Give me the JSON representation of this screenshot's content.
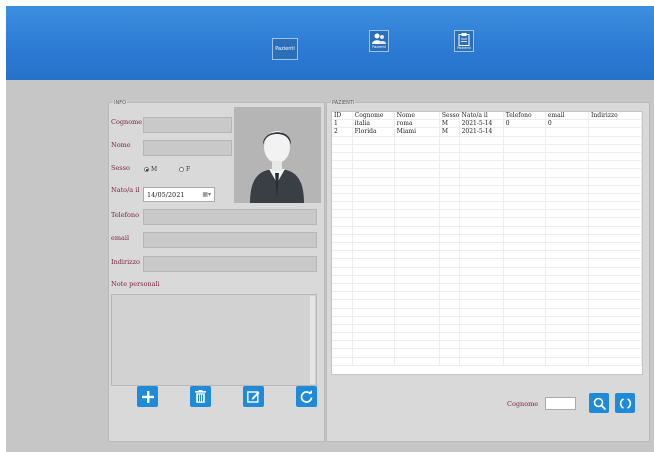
{
  "toolbar": {
    "buttons": [
      {
        "label": "Pazienti",
        "icon": "list-icon"
      },
      {
        "label": "Pazienti",
        "icon": "users-icon"
      },
      {
        "label": "Pazienti",
        "icon": "clipboard-icon"
      }
    ]
  },
  "info": {
    "legend": "INFO",
    "labels": {
      "cognome": "Cognome",
      "nome": "Nome",
      "sesso": "Sesso",
      "nato": "Nato/a il",
      "telefono": "Telefono",
      "email": "email",
      "indirizzo": "Indirizzo",
      "note": "Note personali"
    },
    "values": {
      "cognome": "",
      "nome": "",
      "telefono": "",
      "email": "",
      "indirizzo": "",
      "note": ""
    },
    "sesso_options": [
      "M",
      "F"
    ],
    "sesso_selected": "M",
    "date_value": "14/05/2021"
  },
  "pazienti": {
    "legend": "PAZIENTI",
    "columns": [
      "ID",
      "Cognome",
      "Nome",
      "Sesso",
      "Nato/a il",
      "Telefono",
      "email",
      "Indirizzo"
    ],
    "rows": [
      [
        "1",
        "italia",
        "roma",
        "M",
        "2021-5-14",
        "0",
        "0",
        ""
      ],
      [
        "2",
        "Florida",
        "Miami",
        "M",
        "2021-5-14",
        "",
        "",
        ""
      ]
    ]
  },
  "search": {
    "label": "Cognome",
    "value": ""
  },
  "colors": {
    "topbar": "#2b7ad3",
    "accent_button": "#1f8ad8",
    "label_text": "#7a1e3a",
    "panel_bg": "#d9d9d9"
  }
}
